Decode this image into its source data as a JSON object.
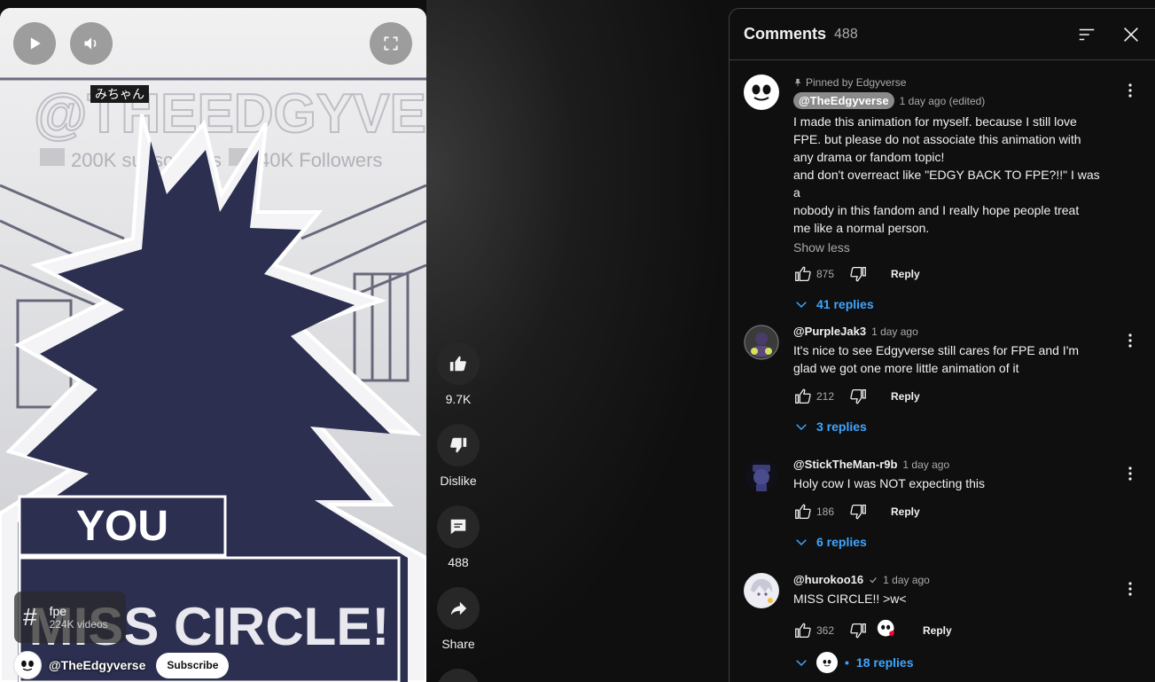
{
  "player": {
    "overlay_tag": "みちゃん",
    "watermark_text": "@THEEDGYVERSE",
    "watermark_sub_left": "200K subscribers",
    "watermark_sub_right": "40K Followers",
    "caption_top": "YOU",
    "caption_bottom": "MISS CIRCLE!",
    "hashtag": {
      "symbol": "#",
      "name": "fpe",
      "count": "224K videos"
    },
    "channel": {
      "handle": "@TheEdgyverse",
      "subscribe_label": "Subscribe"
    }
  },
  "actions": {
    "like_count": "9.7K",
    "dislike_label": "Dislike",
    "comment_count": "488",
    "share_label": "Share"
  },
  "comments_panel": {
    "title": "Comments",
    "count": "488",
    "items": [
      {
        "pinned_label": "Pinned by Edgyverse",
        "author": "@TheEdgyverse",
        "time": "1 day ago (edited)",
        "lines": [
          "I made this animation for myself. because I still love",
          "FPE. but please do not associate this animation with",
          "any drama or fandom topic!",
          "and don't overreact like \"EDGY BACK TO FPE?!!\" I was a",
          "nobody in this fandom and I really hope people treat",
          "me like a normal person."
        ],
        "show_less": "Show less",
        "likes": "875",
        "reply_label": "Reply",
        "replies": "41 replies"
      },
      {
        "author": "@PurpleJak3",
        "time": "1 day ago",
        "lines": [
          "It's nice to see Edgyverse still cares for FPE and I'm",
          "glad we got one more little animation of it"
        ],
        "likes": "212",
        "reply_label": "Reply",
        "replies": "3 replies"
      },
      {
        "author": "@StickTheMan-r9b",
        "time": "1 day ago",
        "lines": [
          "Holy cow I was NOT expecting this"
        ],
        "likes": "186",
        "reply_label": "Reply",
        "replies": "6 replies"
      },
      {
        "author": "@hurokoo16",
        "time": "1 day ago",
        "lines": [
          "MISS CIRCLE!! >w<"
        ],
        "likes": "362",
        "reply_label": "Reply",
        "replies": "18 replies",
        "replies_separator": "•"
      }
    ]
  },
  "colors": {
    "accent_link": "#3ea6ff",
    "background": "#0f0f0f",
    "panel_border": "#3f3f3f",
    "heart": "#ff0033",
    "silhouette": "#2c2f4f"
  },
  "icons": [
    "play-icon",
    "volume-icon",
    "fullscreen-icon",
    "thumb-up-icon",
    "thumb-down-icon",
    "comment-icon",
    "share-icon",
    "more-vert-icon",
    "sort-icon",
    "close-icon",
    "chevron-down-icon",
    "pin-icon",
    "heart-icon"
  ]
}
